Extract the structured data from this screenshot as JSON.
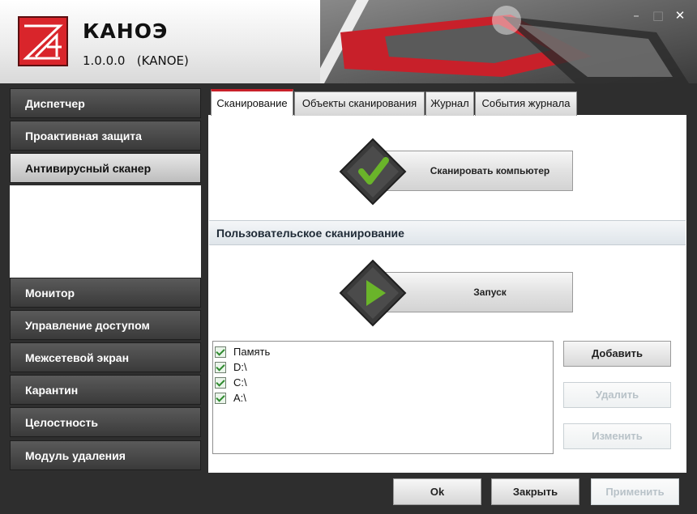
{
  "app": {
    "name": "КАНОЭ",
    "version": "1.0.0.0   (KANOE)"
  },
  "window": {
    "minimize_icon": "minimize-icon",
    "maximize_icon": "maximize-icon",
    "close_icon": "close-icon"
  },
  "sidebar": {
    "items": [
      {
        "label": "Диспетчер"
      },
      {
        "label": "Проактивная защита"
      },
      {
        "label": "Антивирусный сканер",
        "active": true
      },
      {
        "label": "Монитор"
      },
      {
        "label": "Управление доступом"
      },
      {
        "label": "Межсетевой экран"
      },
      {
        "label": "Карантин"
      },
      {
        "label": "Целостность"
      },
      {
        "label": "Модуль удаления"
      }
    ]
  },
  "tabs": [
    {
      "label": "Сканирование",
      "active": true
    },
    {
      "label": "Объекты сканирования"
    },
    {
      "label": "Журнал"
    },
    {
      "label": "События журнала"
    }
  ],
  "scan": {
    "scan_computer_label": "Сканировать компьютер",
    "scan_computer_icon": "check-icon",
    "custom_section_title": "Пользовательское сканирование",
    "start_label": "Запуск",
    "start_icon": "play-icon"
  },
  "scan_list": {
    "items": [
      {
        "label": "Память",
        "checked": true
      },
      {
        "label": "D:\\",
        "checked": true
      },
      {
        "label": "C:\\",
        "checked": true
      },
      {
        "label": "A:\\",
        "checked": true
      }
    ]
  },
  "list_actions": {
    "add": "Добавить",
    "delete": "Удалить",
    "edit": "Изменить"
  },
  "footer": {
    "ok": "Ok",
    "close": "Закрыть",
    "apply": "Применить"
  },
  "colors": {
    "accent_red": "#c8202a",
    "check_green": "#6ab42a",
    "dark_bg": "#2e2e2e"
  }
}
